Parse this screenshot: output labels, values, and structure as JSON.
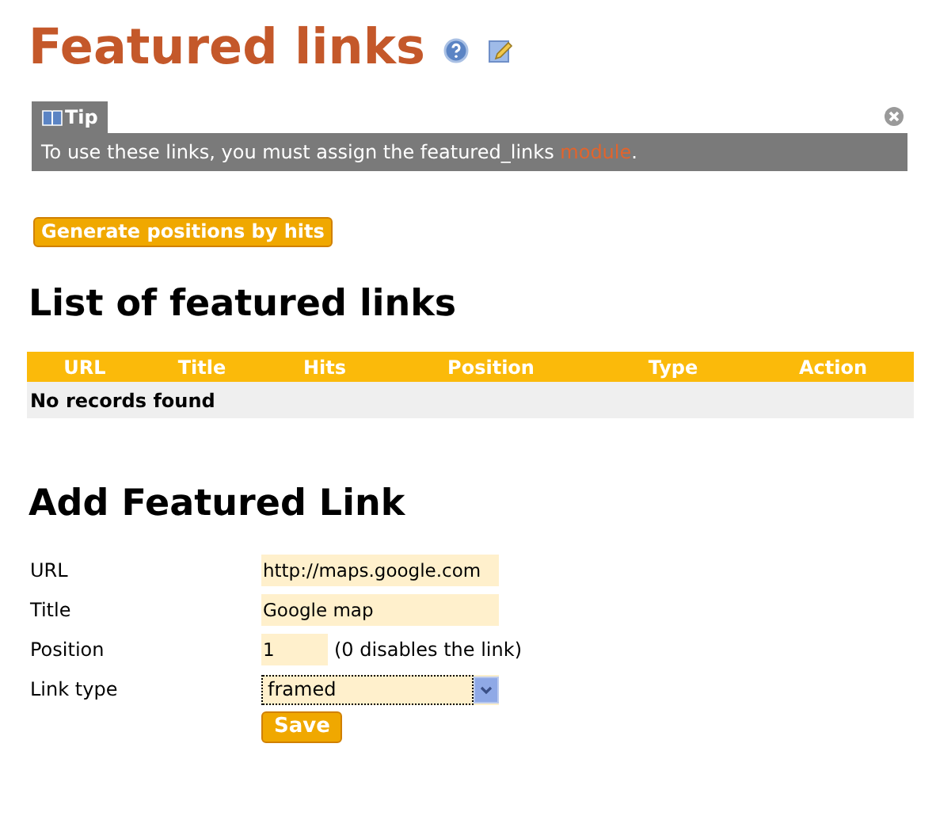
{
  "title": "Featured links",
  "tip": {
    "label": "Tip",
    "text_before": "To use these links, you must assign the featured_links ",
    "link": "module",
    "text_after": "."
  },
  "generate_button": "Generate positions by hits",
  "list_heading": "List of featured links",
  "table": {
    "columns": [
      "URL",
      "Title",
      "Hits",
      "Position",
      "Type",
      "Action"
    ],
    "empty_message": "No records found"
  },
  "form_heading": "Add Featured Link",
  "form": {
    "fields": [
      {
        "kind": "text",
        "label": "URL",
        "value": "http://maps.google.com"
      },
      {
        "kind": "text",
        "label": "Title",
        "value": "Google map"
      },
      {
        "kind": "short",
        "label": "Position",
        "value": "1",
        "hint": "(0 disables the link)"
      },
      {
        "kind": "select",
        "label": "Link type",
        "value": "framed"
      }
    ],
    "submit": "Save"
  }
}
